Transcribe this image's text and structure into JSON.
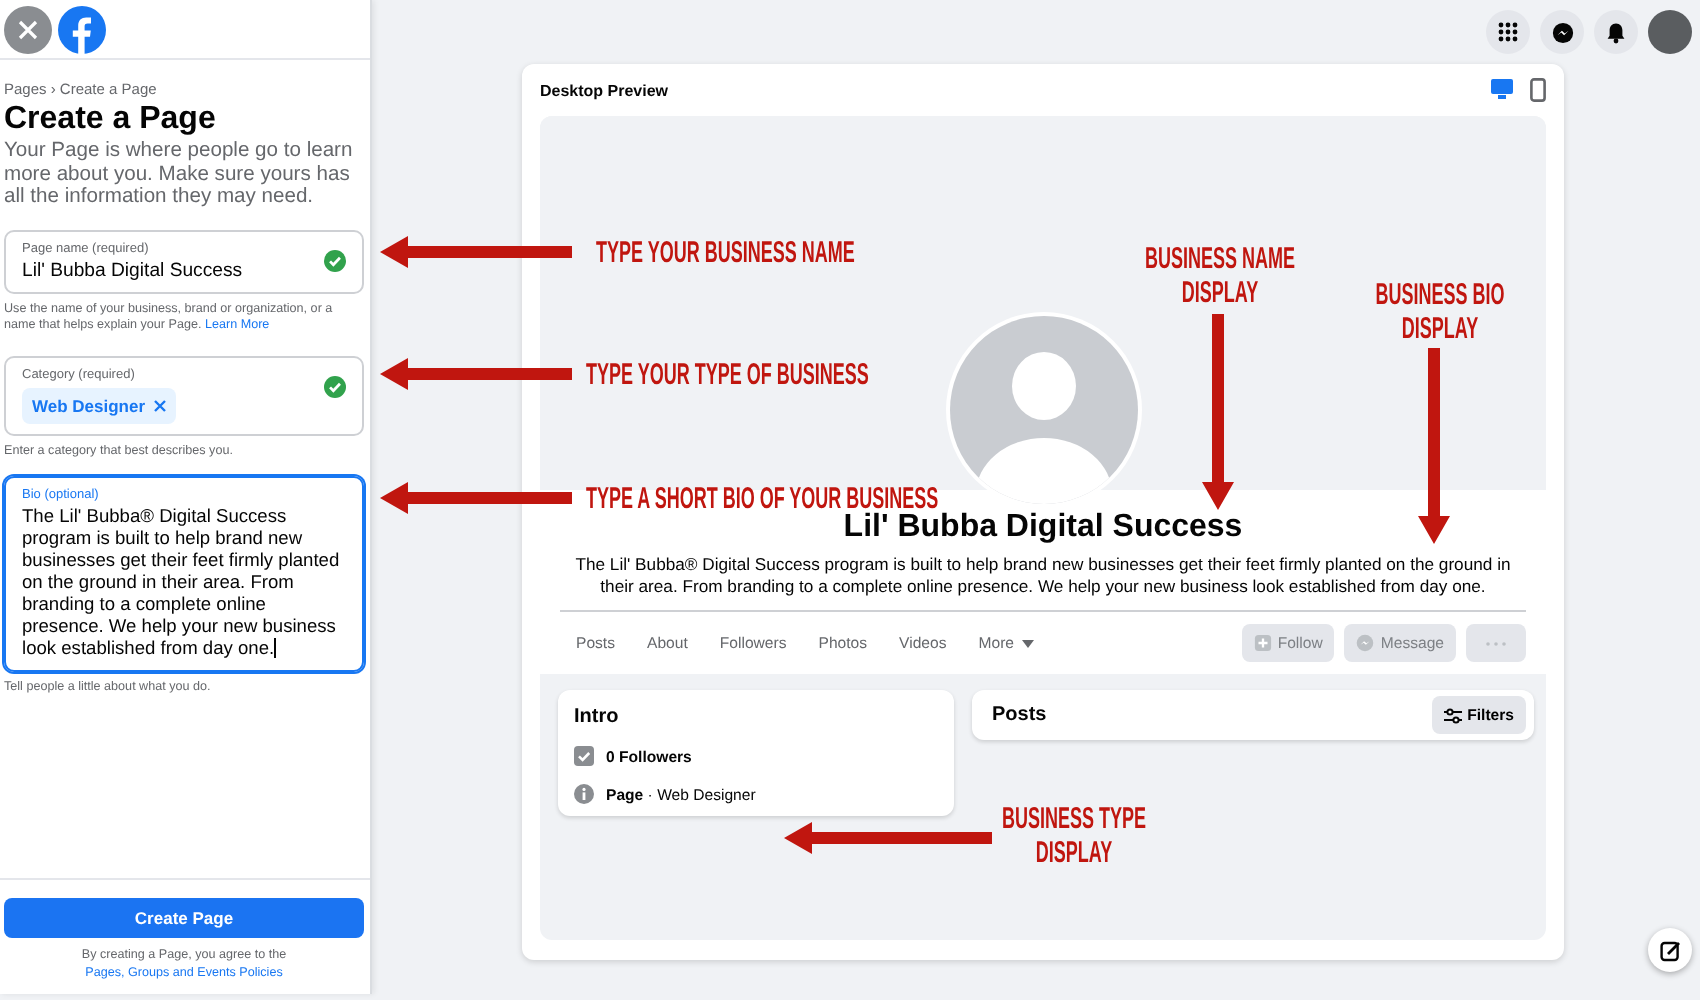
{
  "sidebar": {
    "breadcrumb": "Pages › Create a Page",
    "title": "Create a Page",
    "description": "Your Page is where people go to learn more about you. Make sure yours has all the information they may need.",
    "fields": [
      {
        "kind": "text",
        "label": "Page name (required)",
        "value": "Lil' Bubba Digital Success",
        "valid": true,
        "focused": false,
        "help": "Use the name of your business, brand or organization, or a name that helps explain your Page.",
        "help_link": "Learn More"
      },
      {
        "kind": "chips",
        "label": "Category (required)",
        "chips": [
          "Web Designer"
        ],
        "valid": true,
        "focused": false,
        "help": "Enter a category that best describes you."
      },
      {
        "kind": "textarea",
        "label": "Bio (optional)",
        "value": "The Lil' Bubba® Digital Success program is built to help brand new businesses get their feet firmly planted on the ground in their area. From branding to a complete online presence. We help your new business look established from day one.",
        "valid": false,
        "focused": true,
        "help": "Tell people a little about what you do."
      }
    ],
    "submit": "Create Page",
    "terms": "By creating a Page, you agree to the",
    "terms_link": "Pages, Groups and Events Policies"
  },
  "preview": {
    "title": "Desktop Preview",
    "views": [
      {
        "kind": "desktop",
        "selected": true
      },
      {
        "kind": "mobile",
        "selected": false
      }
    ],
    "page_name": "Lil' Bubba Digital Success",
    "bio": "The Lil' Bubba® Digital Success program is built to help brand new businesses get their feet firmly planted on the ground in their area. From branding to a complete online presence. We help your new business look established from day one.",
    "tabs": [
      {
        "kind": "link",
        "label": "Posts"
      },
      {
        "kind": "link",
        "label": "About"
      },
      {
        "kind": "link",
        "label": "Followers"
      },
      {
        "kind": "link",
        "label": "Photos"
      },
      {
        "kind": "link",
        "label": "Videos"
      },
      {
        "kind": "menu",
        "label": "More"
      }
    ],
    "actions": [
      {
        "kind": "follow",
        "label": "Follow",
        "disabled": true
      },
      {
        "kind": "message",
        "label": "Message",
        "disabled": true
      },
      {
        "kind": "more",
        "disabled": true
      }
    ],
    "intro": {
      "title": "Intro",
      "items": [
        {
          "kind": "followers",
          "text": "**0 Followers**"
        },
        {
          "kind": "info",
          "text": "**Page** · Web Designer"
        }
      ]
    },
    "posts": {
      "title": "Posts",
      "filter": "Filters"
    }
  },
  "annotations": [
    {
      "kind": "left",
      "text": "TYPE YOUR BUSINESS NAME"
    },
    {
      "kind": "left",
      "text": "TYPE YOUR TYPE OF BUSINESS"
    },
    {
      "kind": "left",
      "text": "TYPE A SHORT BIO OF YOUR BUSINESS"
    },
    {
      "kind": "down",
      "text": "BUSINESS NAME DISPLAY"
    },
    {
      "kind": "down",
      "text": "BUSINESS BIO DISPLAY"
    },
    {
      "kind": "left",
      "text": "BUSINESS TYPE DISPLAY"
    }
  ]
}
